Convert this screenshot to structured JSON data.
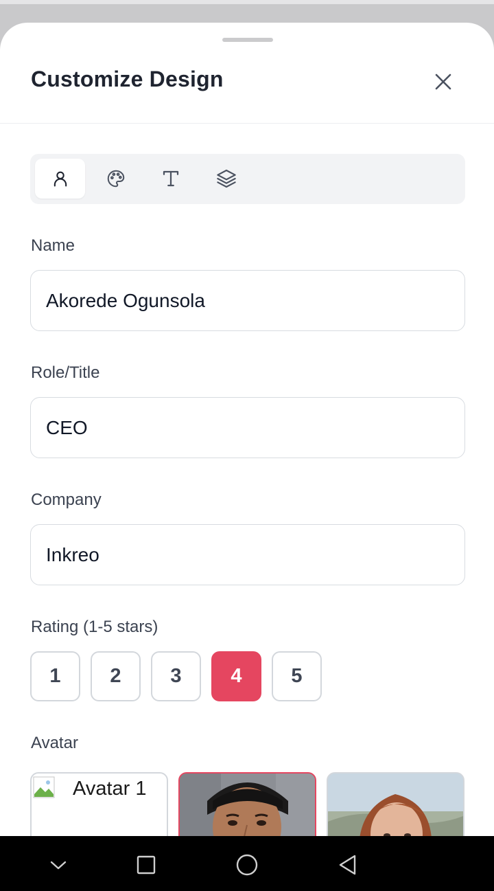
{
  "sheet": {
    "title": "Customize Design",
    "close_icon": "close-icon"
  },
  "tabs": [
    {
      "icon": "user-icon",
      "active": true
    },
    {
      "icon": "palette-icon",
      "active": false
    },
    {
      "icon": "text-type-icon",
      "active": false
    },
    {
      "icon": "layers-icon",
      "active": false
    }
  ],
  "form": {
    "name": {
      "label": "Name",
      "value": "Akorede Ogunsola"
    },
    "role": {
      "label": "Role/Title",
      "value": "CEO"
    },
    "company": {
      "label": "Company",
      "value": "Inkreo"
    },
    "rating": {
      "label": "Rating (1-5 stars)",
      "options": [
        "1",
        "2",
        "3",
        "4",
        "5"
      ],
      "selected": 4
    },
    "avatar": {
      "label": "Avatar",
      "options": [
        {
          "alt": "Avatar 1",
          "selected": false
        },
        {
          "selected": true
        },
        {
          "selected": false
        }
      ]
    }
  },
  "colors": {
    "accent": "#e54660",
    "border": "#d3d7dc",
    "tab_bg": "#f2f3f5",
    "label": "#3b4250"
  },
  "system_nav": [
    "chevron-down-icon",
    "recents-square-icon",
    "home-circle-icon",
    "back-triangle-icon"
  ]
}
